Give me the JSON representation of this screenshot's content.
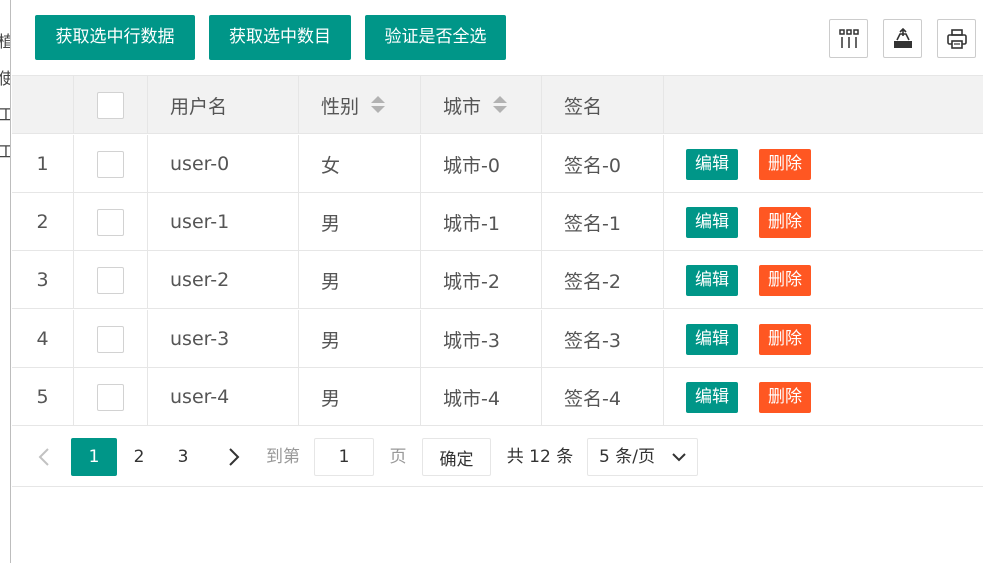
{
  "sidebar_remnant": [
    "植",
    "使",
    "工",
    "工"
  ],
  "toolbar": {
    "buttons": [
      {
        "label": "获取选中行数据"
      },
      {
        "label": "获取选中数目"
      },
      {
        "label": "验证是否全选"
      }
    ],
    "icons": [
      "columns-filter-icon",
      "export-icon",
      "print-icon"
    ]
  },
  "table": {
    "headers": {
      "username": "用户名",
      "sex": "性别",
      "city": "城市",
      "sign": "签名"
    },
    "rows": [
      {
        "num": "1",
        "username": "user-0",
        "sex": "女",
        "city": "城市-0",
        "sign": "签名-0"
      },
      {
        "num": "2",
        "username": "user-1",
        "sex": "男",
        "city": "城市-1",
        "sign": "签名-1"
      },
      {
        "num": "3",
        "username": "user-2",
        "sex": "男",
        "city": "城市-2",
        "sign": "签名-2"
      },
      {
        "num": "4",
        "username": "user-3",
        "sex": "男",
        "city": "城市-3",
        "sign": "签名-3"
      },
      {
        "num": "5",
        "username": "user-4",
        "sex": "男",
        "city": "城市-4",
        "sign": "签名-4"
      }
    ],
    "actions": {
      "edit": "编辑",
      "delete": "删除"
    }
  },
  "pager": {
    "pages": [
      "1",
      "2",
      "3"
    ],
    "current": "1",
    "goto_label": "到第",
    "goto_value": "1",
    "page_unit": "页",
    "confirm_label": "确定",
    "total_label": "共 12 条",
    "page_size": "5 条/页"
  },
  "colors": {
    "primary": "#009688",
    "danger": "#ff5722"
  }
}
